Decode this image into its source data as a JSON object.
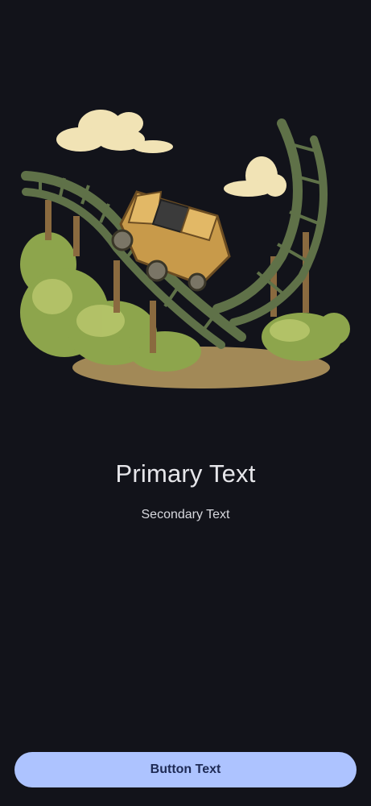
{
  "content": {
    "primary_text": "Primary Text",
    "secondary_text": "Secondary Text"
  },
  "footer": {
    "button_label": "Button Text"
  },
  "illustration": {
    "icon": "roller-coaster-illustration"
  },
  "colors": {
    "background": "#12131a",
    "button_fill": "#adc3ff",
    "button_text": "#1e2a55",
    "primary_text": "#e6e6ea",
    "secondary_text": "#d7d8de"
  }
}
